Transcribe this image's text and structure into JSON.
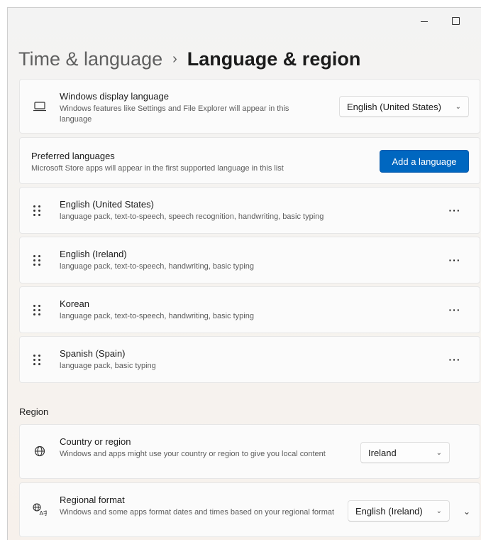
{
  "titlebar": {
    "minimize": "—",
    "maximize": "",
    "close": "×"
  },
  "header": {
    "parent": "Time & language",
    "separator": "›",
    "current": "Language & region"
  },
  "display_language": {
    "title": "Windows display language",
    "description": "Windows features like Settings and File Explorer will appear in this language",
    "selected": "English (United States)",
    "icon": "laptop-icon"
  },
  "preferred": {
    "title": "Preferred languages",
    "description": "Microsoft Store apps will appear in the first supported language in this list",
    "add_button": "Add a language"
  },
  "languages": [
    {
      "name": "English (United States)",
      "features": "language pack, text-to-speech, speech recognition, handwriting, basic typing"
    },
    {
      "name": "English (Ireland)",
      "features": "language pack, text-to-speech, handwriting, basic typing"
    },
    {
      "name": "Korean",
      "features": "language pack, text-to-speech, handwriting, basic typing"
    },
    {
      "name": "Spanish (Spain)",
      "features": "language pack, basic typing"
    }
  ],
  "more_label": "···",
  "region": {
    "section_label": "Region",
    "country": {
      "title": "Country or region",
      "description": "Windows and apps might use your country or region to give you local content",
      "selected": "Ireland",
      "icon": "globe-icon"
    },
    "format": {
      "title": "Regional format",
      "description": "Windows and some apps format dates and times based on your regional format",
      "selected": "English (Ireland)",
      "icon": "language-format-icon"
    }
  },
  "colors": {
    "accent": "#0067c0"
  }
}
